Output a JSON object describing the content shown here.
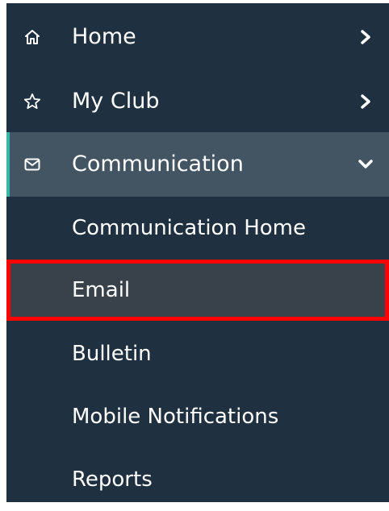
{
  "sidebar": {
    "items": [
      {
        "label": "Home",
        "icon": "home-icon",
        "chevron": "chevron-right-icon"
      },
      {
        "label": "My Club",
        "icon": "star-icon",
        "chevron": "chevron-right-icon"
      },
      {
        "label": "Communication",
        "icon": "envelope-icon",
        "chevron": "chevron-down-icon",
        "expanded": true,
        "children": [
          {
            "label": "Communication Home"
          },
          {
            "label": "Email",
            "highlighted": true
          },
          {
            "label": "Bulletin"
          },
          {
            "label": "Mobile Notifications"
          },
          {
            "label": "Reports"
          }
        ]
      }
    ]
  },
  "colors": {
    "sidebar_bg": "#1f3140",
    "active_bg": "#435463",
    "active_accent": "#37b8a4",
    "selected_bg": "#39424b",
    "highlight_border": "#ff0000",
    "text": "#ffffff"
  }
}
